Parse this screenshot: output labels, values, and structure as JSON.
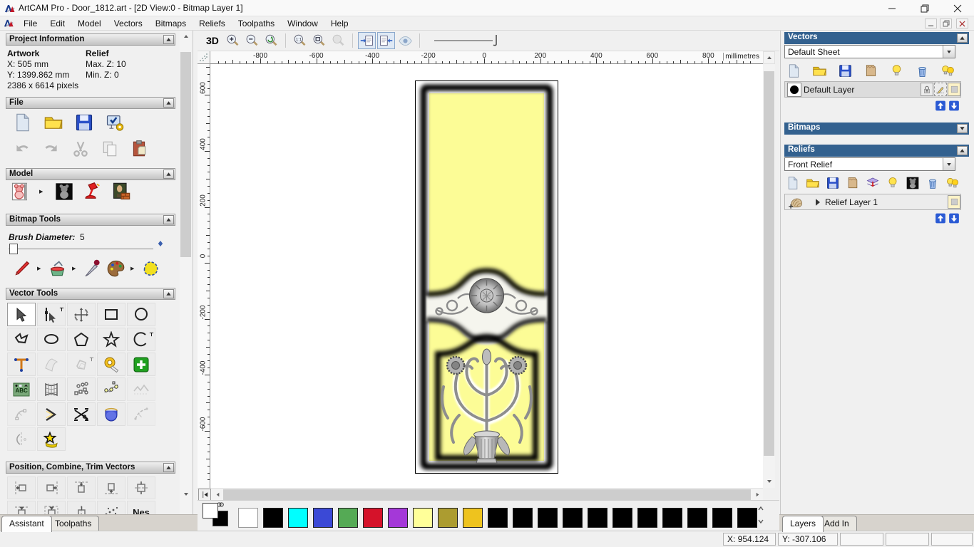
{
  "window": {
    "title": "ArtCAM Pro - Door_1812.art - [2D View:0 - Bitmap Layer 1]"
  },
  "menu": {
    "items": [
      "File",
      "Edit",
      "Model",
      "Vectors",
      "Bitmaps",
      "Reliefs",
      "Toolpaths",
      "Window",
      "Help"
    ]
  },
  "assistant": {
    "project_information": {
      "title": "Project Information",
      "artwork_label": "Artwork",
      "relief_label": "Relief",
      "x": "X: 505 mm",
      "y": "Y: 1399.862 mm",
      "pixels": "2386 x 6614 pixels",
      "max_z": "Max. Z: 10",
      "min_z": "Min. Z: 0"
    },
    "file_section": {
      "title": "File",
      "rows": [
        [
          {
            "icon": "new-model"
          },
          {
            "icon": "open-file"
          },
          {
            "icon": "save-file"
          },
          {
            "icon": "model-properties"
          }
        ],
        [
          {
            "icon": "undo"
          },
          {
            "icon": "redo"
          },
          {
            "icon": "cut"
          },
          {
            "icon": "copy"
          },
          {
            "icon": "notes"
          }
        ]
      ]
    },
    "model_section": {
      "title": "Model",
      "icons": [
        {
          "icon": "set-model-size",
          "flyout": true
        },
        {
          "icon": "invert-model"
        },
        {
          "icon": "lighting"
        },
        {
          "icon": "texture-relief"
        }
      ]
    },
    "bitmap_tools": {
      "title": "Bitmap Tools",
      "brush_label": "Brush Diameter:",
      "brush_value": "5",
      "icons": [
        {
          "icon": "paint-brush",
          "flyout": true
        },
        {
          "icon": "flood-fill",
          "flyout": true
        },
        {
          "icon": "colour-picker"
        },
        {
          "icon": "palette",
          "flyout": true
        },
        {
          "icon": "solid-fill"
        }
      ]
    },
    "vector_tools": {
      "title": "Vector Tools",
      "tools": [
        {
          "icon": "select-vectors",
          "state": "active"
        },
        {
          "icon": "node-editing",
          "flyout": true
        },
        {
          "icon": "transform-vectors"
        },
        {
          "icon": "create-rectangle"
        },
        {
          "icon": "create-circle"
        },
        {
          "icon": "create-polyline"
        },
        {
          "icon": "create-ellipse"
        },
        {
          "icon": "create-polygon"
        },
        {
          "icon": "create-star"
        },
        {
          "icon": "create-arc",
          "flyout": true
        },
        {
          "icon": "create-text"
        },
        {
          "icon": "wrap-text",
          "state": "disabled"
        },
        {
          "icon": "offset-vectors",
          "state": "disabled",
          "flyout": true
        },
        {
          "icon": "measure-tool"
        },
        {
          "icon": "paste-new"
        },
        {
          "icon": "text-in-block"
        },
        {
          "icon": "envelope-distortion"
        },
        {
          "icon": "block-copy"
        },
        {
          "icon": "fit-curve"
        },
        {
          "icon": "simplify-vectors",
          "state": "disabled"
        },
        {
          "icon": "fit-arcs",
          "state": "disabled"
        },
        {
          "icon": "create-bisector"
        },
        {
          "icon": "trim-vectors"
        },
        {
          "icon": "interactive-distortion"
        },
        {
          "icon": "join-vectors",
          "state": "disabled"
        },
        {
          "icon": "mirror-vectors",
          "state": "disabled"
        },
        {
          "icon": "wrap-star"
        }
      ]
    },
    "position_section": {
      "title": "Position, Combine, Trim Vectors",
      "row1": [
        {
          "icon": "align-left"
        },
        {
          "icon": "align-right"
        },
        {
          "icon": "align-top"
        },
        {
          "icon": "align-bottom"
        },
        {
          "icon": "align-center"
        }
      ],
      "row2": [
        {
          "icon": "align-center-v"
        },
        {
          "icon": "align-center-h"
        },
        {
          "icon": "align-middle"
        },
        {
          "icon": "spread-points"
        },
        {
          "icon": "nesting"
        }
      ]
    },
    "tabs": [
      {
        "label": "Assistant",
        "active": true
      },
      {
        "label": "Toolpaths",
        "active": false
      }
    ]
  },
  "view_toolbar": {
    "button_3d": "3D",
    "items": [
      {
        "t": "3d"
      },
      {
        "t": "i",
        "icon": "zoom-in"
      },
      {
        "t": "i",
        "icon": "zoom-out"
      },
      {
        "t": "i",
        "icon": "zoom-previous"
      },
      {
        "t": "s"
      },
      {
        "t": "i",
        "icon": "zoom-1to1"
      },
      {
        "t": "i",
        "icon": "zoom-fit"
      },
      {
        "t": "i",
        "icon": "zoom-object",
        "disabled": true
      },
      {
        "t": "s"
      },
      {
        "t": "i",
        "icon": "toggle-bitmap-view",
        "sunken": true
      },
      {
        "t": "i",
        "icon": "toggle-vector-view",
        "sunken": true
      },
      {
        "t": "i",
        "icon": "relief-preview",
        "disabled": true
      },
      {
        "t": "s"
      },
      {
        "t": "slider"
      }
    ]
  },
  "rulers": {
    "unit": "millimetres",
    "h_labels": [
      "-800",
      "-600",
      "-400",
      "-200",
      "0",
      "200",
      "400",
      "600",
      "800"
    ],
    "v_labels": [
      "600",
      "400",
      "200",
      "0",
      "-200",
      "-400",
      "-600"
    ]
  },
  "palette": {
    "swatches": [
      "#ffffff",
      "#000000",
      "#00ffff",
      "#3b49d6",
      "#55aa55",
      "#d5122a",
      "#a438d8",
      "#ffff99",
      "#ac9c30",
      "#eec31e",
      "#000000",
      "#000000",
      "#000000",
      "#000000",
      "#000000",
      "#000000",
      "#000000",
      "#000000",
      "#000000",
      "#000000",
      "#000000"
    ]
  },
  "right_panel": {
    "vectors": {
      "title": "Vectors",
      "sheet_value": "Default Sheet",
      "layer_name": "Default Layer",
      "toolbar": [
        {
          "icon": "new-sheet"
        },
        {
          "icon": "open-vectors"
        },
        {
          "icon": "save-vectors"
        },
        {
          "icon": "import-vectors"
        },
        {
          "icon": "show-layer"
        },
        {
          "icon": "delete-layer"
        },
        {
          "icon": "toggle-all-layers"
        }
      ]
    },
    "bitmaps": {
      "title": "Bitmaps"
    },
    "reliefs": {
      "title": "Reliefs",
      "relief_value": "Front Relief",
      "layer_name": "Relief Layer 1",
      "toolbar": [
        {
          "icon": "new-relief"
        },
        {
          "icon": "open-relief"
        },
        {
          "icon": "save-relief"
        },
        {
          "icon": "import-relief"
        },
        {
          "icon": "combine-relief"
        },
        {
          "icon": "show-relief-layer"
        },
        {
          "icon": "greyscale-preview"
        },
        {
          "icon": "delete-relief-layer"
        },
        {
          "icon": "toggle-all-relief-layers"
        }
      ]
    },
    "tabs": [
      {
        "label": "Layers",
        "active": true
      },
      {
        "label": "Add In",
        "active": false
      }
    ]
  },
  "status_bar": {
    "x": "X: 954.124",
    "y": "Y: -307.106"
  },
  "colors": {
    "panel_header_blue": "#33618f",
    "artwork_yellow": "#fcfc96",
    "canvas_white": "#ffffff",
    "arrow_button_blue": "#2a5ad4"
  }
}
